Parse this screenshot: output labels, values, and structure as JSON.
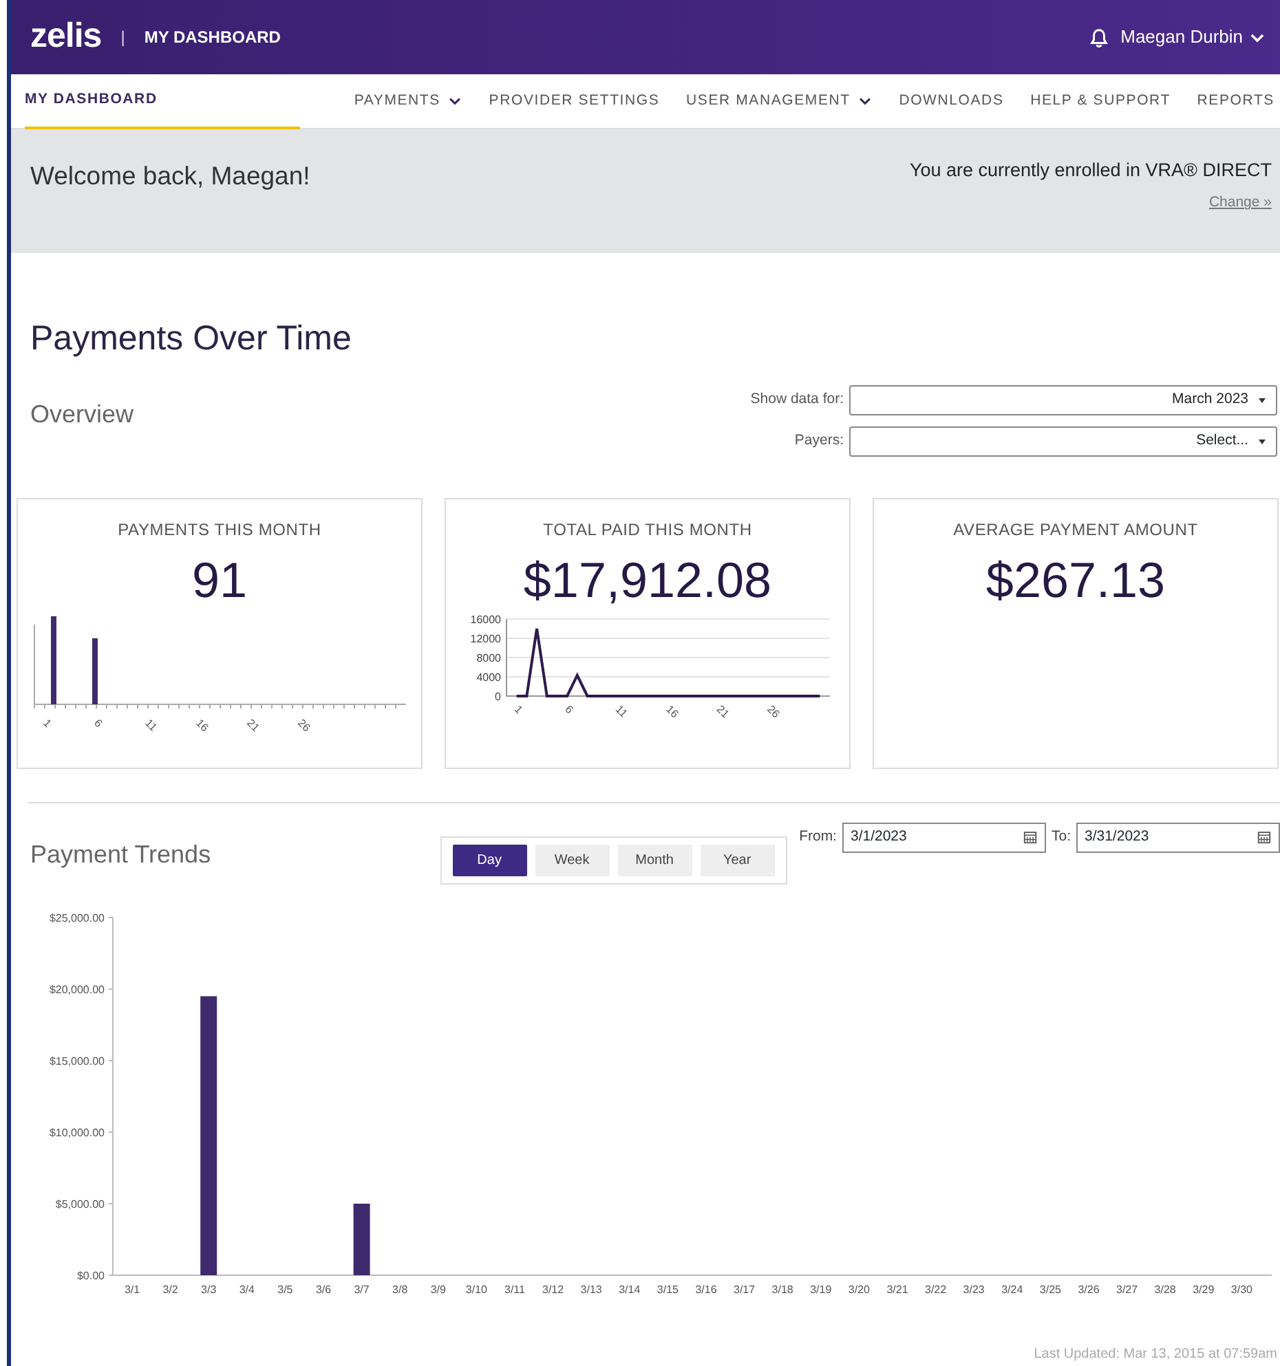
{
  "header": {
    "logo": "zelis",
    "separator": "|",
    "title": "MY DASHBOARD",
    "user": "Maegan Durbin"
  },
  "nav": [
    {
      "label": "MY DASHBOARD",
      "selected": true,
      "dropdown": false
    },
    {
      "label": "PAYMENTS",
      "selected": false,
      "dropdown": true
    },
    {
      "label": "PROVIDER SETTINGS",
      "selected": false,
      "dropdown": false
    },
    {
      "label": "USER MANAGEMENT",
      "selected": false,
      "dropdown": true
    },
    {
      "label": "DOWNLOADS",
      "selected": false,
      "dropdown": false
    },
    {
      "label": "HELP & SUPPORT",
      "selected": false,
      "dropdown": false
    },
    {
      "label": "REPORTS",
      "selected": false,
      "dropdown": false
    }
  ],
  "welcome": {
    "greeting": "Welcome back, Maegan!",
    "enrollment": "You are currently enrolled in VRA® DIRECT",
    "change_link": "Change »"
  },
  "page_title": "Payments Over Time",
  "overview": {
    "title": "Overview",
    "filters": [
      {
        "label": "Show data for:",
        "value": "March 2023"
      },
      {
        "label": "Payers:",
        "value": "Select..."
      }
    ]
  },
  "cards": [
    {
      "title": "PAYMENTS THIS MONTH",
      "value": "91",
      "x_labels": [
        "1",
        "6",
        "11",
        "16",
        "21",
        "26"
      ]
    },
    {
      "title": "TOTAL PAID THIS MONTH",
      "value": "$17,912.08",
      "chart_data": {
        "type": "line",
        "x": [
          1,
          2,
          3,
          4,
          5,
          6,
          7,
          8,
          9,
          10,
          11,
          12,
          13,
          14,
          15,
          16,
          17,
          18,
          19,
          20,
          21,
          22,
          23,
          24,
          25,
          26,
          27,
          28,
          29,
          30,
          31
        ],
        "series": [
          {
            "color": "#2d1a4f",
            "values": [
              0,
              0,
              14000,
              0,
              0,
              0,
              4300,
              0,
              0,
              0,
              0,
              0,
              0,
              0,
              0,
              0,
              0,
              0,
              0,
              0,
              0,
              0,
              0,
              0,
              0,
              0,
              0,
              0,
              0,
              0,
              0
            ]
          }
        ],
        "xlim": [
          0,
          32
        ],
        "grid": true,
        "xticks": [
          1,
          6,
          11,
          16,
          21,
          26
        ],
        "yticks": [
          0,
          4000,
          8000,
          12000,
          16000
        ],
        "ylim": [
          0,
          16000
        ]
      }
    },
    {
      "title": "AVERAGE PAYMENT AMOUNT",
      "value": "$267.13"
    }
  ],
  "trends": {
    "title": "Payment Trends",
    "ranges": [
      {
        "label": "Day",
        "selected": true
      },
      {
        "label": "Week",
        "selected": false
      },
      {
        "label": "Month",
        "selected": false
      },
      {
        "label": "Year",
        "selected": false
      }
    ],
    "from_label": "From:",
    "from_value": "3/1/2023",
    "to_label": "To:",
    "to_value": "3/31/2023",
    "chart_data": {
      "type": "bar",
      "categories": [
        "3/1",
        "3/2",
        "3/3",
        "3/4",
        "3/5",
        "3/6",
        "3/7",
        "3/8",
        "3/9",
        "3/10",
        "3/11",
        "3/12",
        "3/13",
        "3/14",
        "3/15",
        "3/16",
        "3/17",
        "3/18",
        "3/19",
        "3/20",
        "3/21",
        "3/22",
        "3/23",
        "3/24",
        "3/25",
        "3/26",
        "3/27",
        "3/28",
        "3/29",
        "3/30"
      ],
      "series": [
        {
          "color": "#3f2a6d",
          "values": [
            0,
            0,
            19500,
            0,
            0,
            0,
            5000,
            0,
            0,
            0,
            0,
            0,
            0,
            0,
            0,
            0,
            0,
            0,
            0,
            0,
            0,
            0,
            0,
            0,
            0,
            0,
            0,
            0,
            0,
            0
          ]
        }
      ],
      "ylim": [
        0,
        25000
      ],
      "yticks": [
        {
          "value": 0,
          "label": "$0.00"
        },
        {
          "value": 5000,
          "label": "$5,000.00"
        },
        {
          "value": 10000,
          "label": "$10,000.00"
        },
        {
          "value": 15000,
          "label": "$15,000.00"
        },
        {
          "value": 20000,
          "label": "$20,000.00"
        },
        {
          "value": 25000,
          "label": "$25,000.00"
        }
      ]
    },
    "last_updated": "Last Updated: Mar 13, 2015 at 07:59am"
  }
}
